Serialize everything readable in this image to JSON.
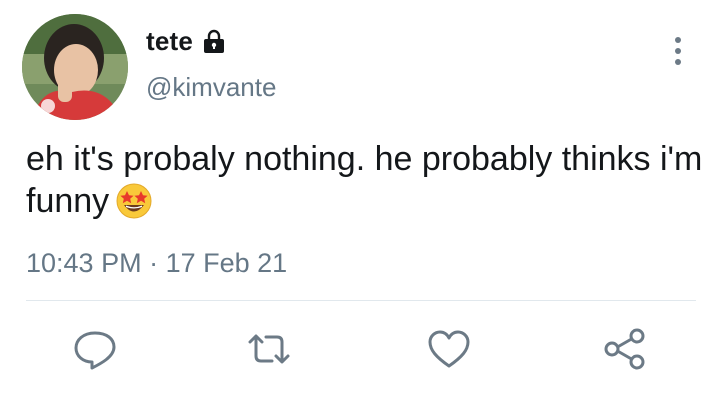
{
  "tweet": {
    "display_name": "tete",
    "handle": "@kimvante",
    "text": "eh it's probaly nothing. he probably thinks i'm funny",
    "emoji": "star-struck-emoji",
    "time": "10:43 PM",
    "separator": " · ",
    "date": "17 Feb 21"
  },
  "icons": {
    "lock": "lock-icon",
    "more": "more-vertical-icon",
    "reply": "reply-icon",
    "retweet": "retweet-icon",
    "like": "heart-icon",
    "share": "share-icon"
  },
  "colors": {
    "text": "#14171a",
    "secondary": "#657786",
    "divider": "#e1e8ed",
    "icon": "#6c7a86"
  }
}
